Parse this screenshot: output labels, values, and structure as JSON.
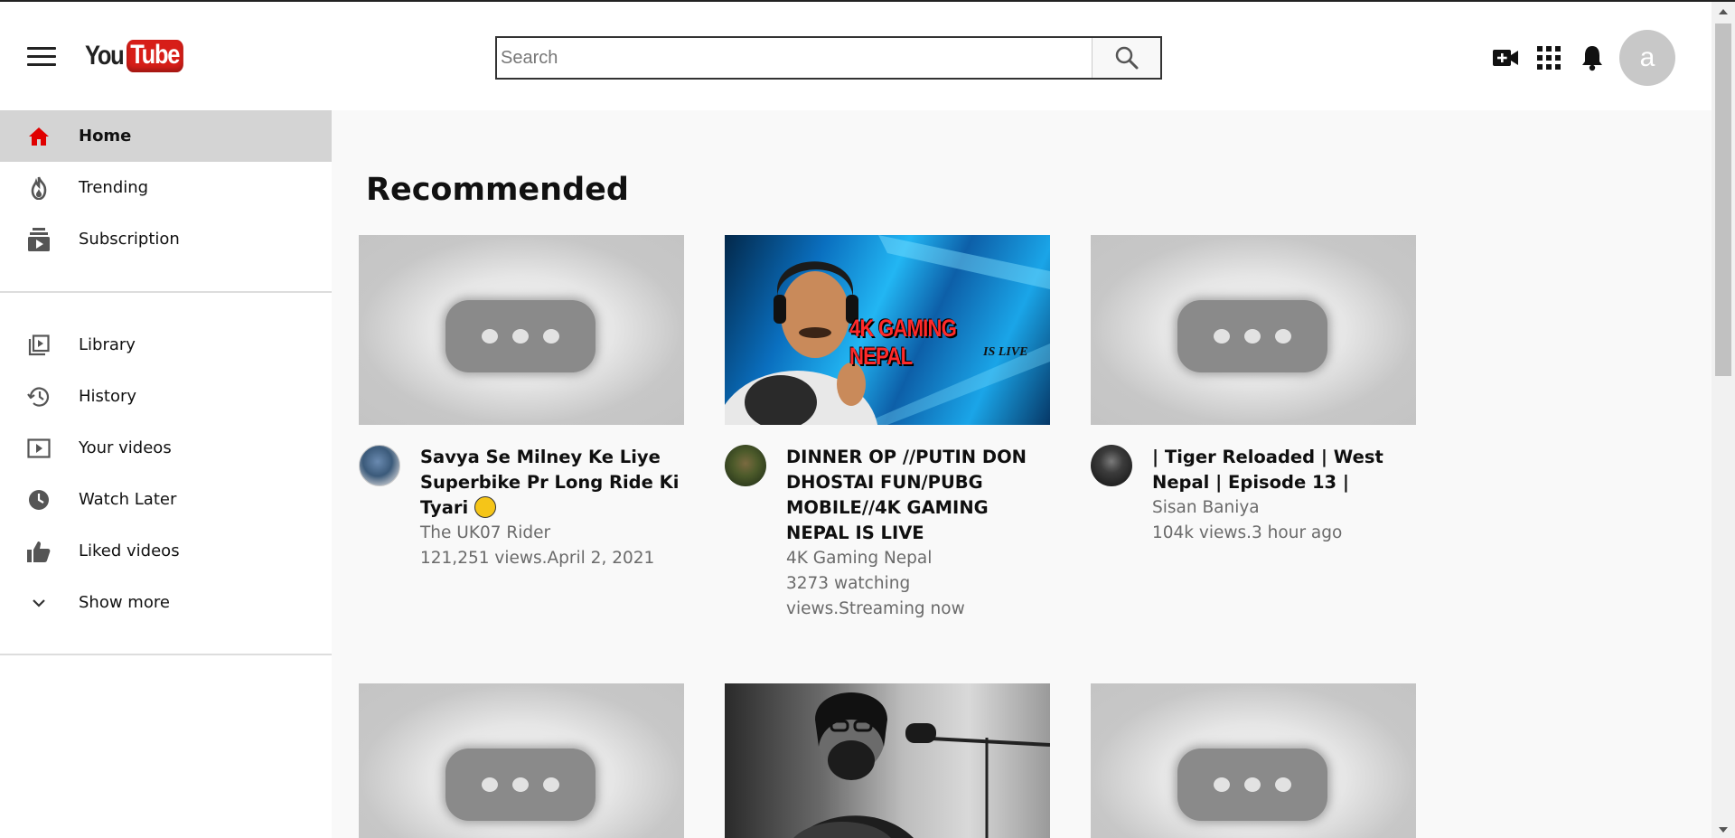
{
  "header": {
    "logo_you": "You",
    "logo_tube": "Tube",
    "search_placeholder": "Search",
    "avatar_letter": "a"
  },
  "sidebar": {
    "primary": [
      {
        "label": "Home",
        "icon": "home-icon",
        "active": true
      },
      {
        "label": "Trending",
        "icon": "fire-icon"
      },
      {
        "label": "Subscription",
        "icon": "subscription-icon"
      }
    ],
    "secondary": [
      {
        "label": "Library",
        "icon": "library-icon"
      },
      {
        "label": "History",
        "icon": "history-icon"
      },
      {
        "label": "Your videos",
        "icon": "your-videos-icon"
      },
      {
        "label": "Watch Later",
        "icon": "clock-icon"
      },
      {
        "label": "Liked videos",
        "icon": "thumbs-up-icon"
      },
      {
        "label": "Show more",
        "icon": "chevron-down-icon"
      }
    ]
  },
  "main": {
    "section_title": "Recommended",
    "videos": [
      {
        "title": "Savya Se Milney Ke Liye Superbike Pr Long Ride Ki Tyari",
        "channel": "The UK07 Rider",
        "stats": "121,251 views.April 2, 2021",
        "thumbnail": "placeholder"
      },
      {
        "title": "DINNER OP //PUTIN DON DHOSTAI FUN/PUBG MOBILE//4K GAMING NEPAL IS LIVE",
        "channel": "4K Gaming Nepal",
        "stats": "3273 watching views.Streaming now",
        "thumbnail": "gaming",
        "thumb_text": "4K GAMING NEPAL",
        "thumb_subtext": "IS LIVE"
      },
      {
        "title": "| Tiger Reloaded | West Nepal | Episode 13 |",
        "channel": "Sisan Baniya",
        "stats": "104k views.3 hour ago",
        "thumbnail": "placeholder"
      }
    ]
  },
  "colors": {
    "brand_red": "#d71e18",
    "active_bg": "#d4d4d4",
    "page_bg": "#f9f9f9"
  }
}
